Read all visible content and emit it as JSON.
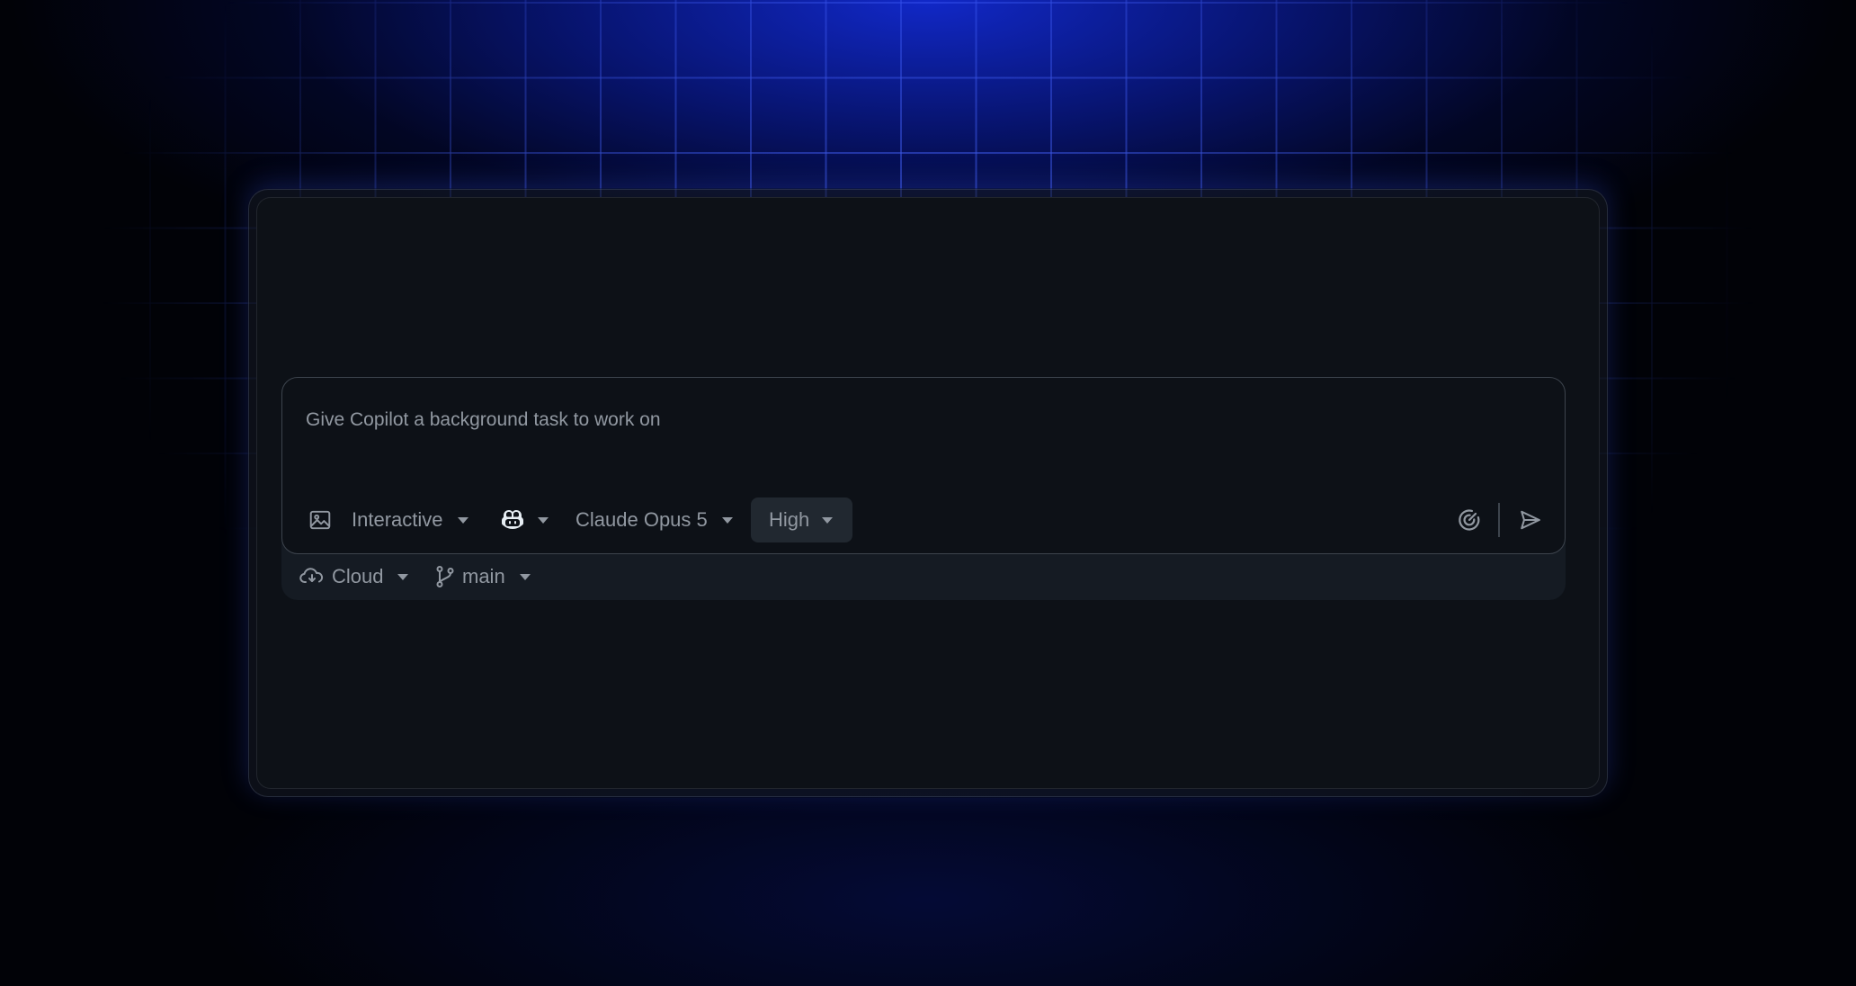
{
  "composer": {
    "placeholder": "Give Copilot a background task to work on",
    "value": ""
  },
  "toolbar": {
    "attach_icon": "image-icon",
    "mode_label": "Interactive",
    "agent_icon": "copilot-icon",
    "model_label": "Claude Opus 5",
    "effort_label": "High",
    "tasks_icon": "target-icon",
    "send_icon": "paper-airplane-icon"
  },
  "footer": {
    "environment_label": "Cloud",
    "environment_icon": "cloud-icon",
    "branch_label": "main",
    "branch_icon": "git-branch-icon"
  },
  "colors": {
    "text_muted": "#9198a1",
    "panel_bg": "#0d1117",
    "footer_bg": "#151b23",
    "pill_bg": "#212830",
    "border": "#3d444d",
    "glow": "#1a2fd6"
  }
}
